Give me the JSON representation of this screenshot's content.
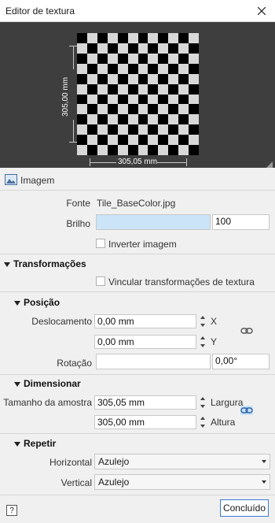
{
  "window": {
    "title": "Editor de textura"
  },
  "preview": {
    "width_label": "305,05 mm",
    "height_label": "305,00 mm"
  },
  "image_section": {
    "tab_label": "Imagem",
    "source_label": "Fonte",
    "source_value": "Tile_BaseColor.jpg",
    "brightness_label": "Brilho",
    "brightness_value": "100",
    "invert_label": "Inverter imagem"
  },
  "transforms": {
    "title": "Transformações",
    "link_label": "Vincular transformações de textura",
    "position": {
      "title": "Posição",
      "offset_label": "Deslocamento",
      "offset_x": "0,00 mm",
      "x_axis": "X",
      "offset_y": "0,00 mm",
      "y_axis": "Y",
      "rotation_label": "Rotação",
      "rotation_value": "0,00°"
    },
    "scale": {
      "title": "Dimensionar",
      "sample_label": "Tamanho da amostra",
      "width_value": "305,05 mm",
      "width_label": "Largura",
      "height_value": "305,00 mm",
      "height_label": "Altura"
    },
    "repeat": {
      "title": "Repetir",
      "horizontal_label": "Horizontal",
      "horizontal_value": "Azulejo",
      "vertical_label": "Vertical",
      "vertical_value": "Azulejo"
    }
  },
  "footer": {
    "help": "?",
    "done_label": "Concluído"
  },
  "colors": {
    "accent": "#3a7bd5",
    "preview_bg": "#3e3e3e",
    "brightness_bar": "#cce4f7"
  },
  "icons": {
    "close": "close-icon",
    "image": "image-icon",
    "link": "link-icon",
    "help": "help-icon"
  }
}
